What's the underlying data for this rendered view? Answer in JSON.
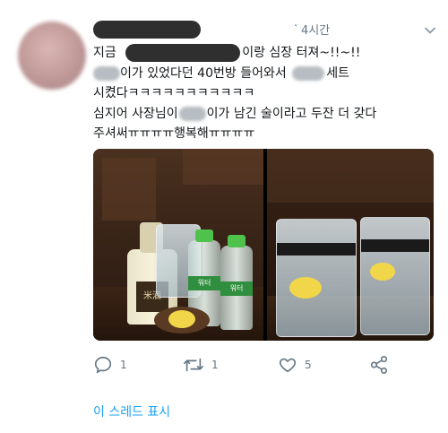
{
  "tweet": {
    "time": "4시간",
    "separator": "·",
    "lines": [
      {
        "parts": [
          "지금",
          "이랑 심장 터져~!!~!!"
        ]
      },
      {
        "parts": [
          "이가 있었다던 40번방 들어와서",
          "세트"
        ]
      },
      {
        "parts": [
          "시켰다ㅋㅋㅋㅋㅋㅋㅋㅋㅋㅋㅋ"
        ]
      },
      {
        "parts": [
          "심지어 사장님이",
          "이가 남긴 술이라고 두잔 더 갖다"
        ]
      },
      {
        "parts": [
          "주셔써ㅠㅠㅠㅠ행복해ㅠㅠㅠㅠ"
        ]
      }
    ],
    "bottle_label": "米酒",
    "water_label": "워터"
  },
  "actions": {
    "reply_count": "1",
    "retweet_count": "1",
    "like_count": "5"
  },
  "thread_link": "이 스레드 표시",
  "colors": {
    "accent": "#1da1f2",
    "muted": "#657786",
    "text": "#14171a"
  },
  "icons": [
    "chevron-down-icon",
    "reply-icon",
    "retweet-icon",
    "like-icon",
    "share-icon"
  ]
}
